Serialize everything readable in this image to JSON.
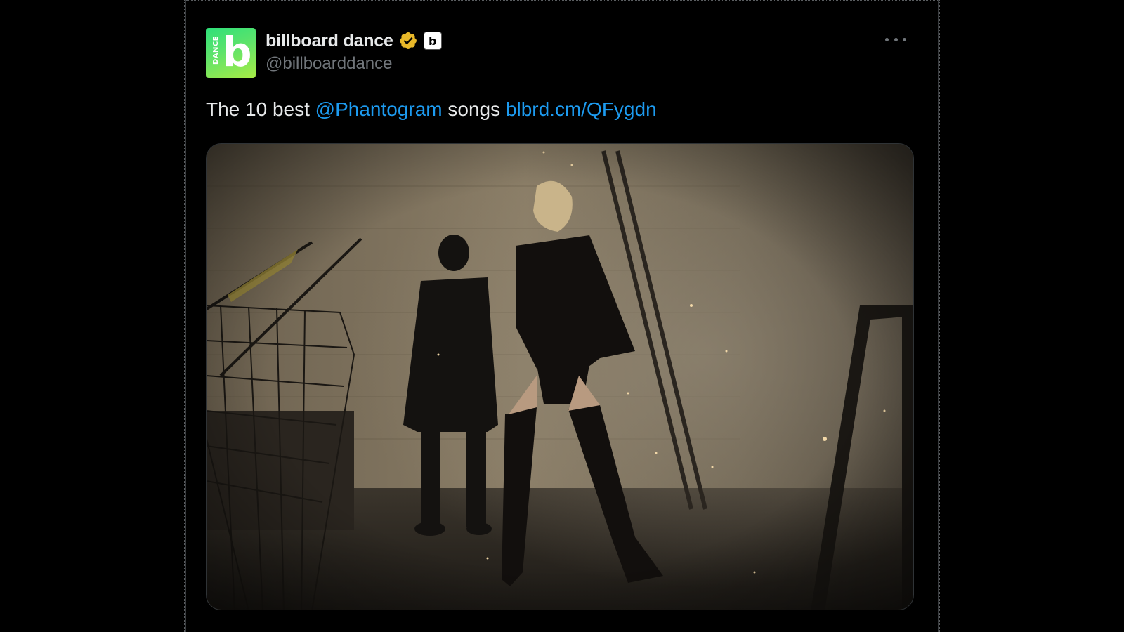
{
  "account": {
    "display_name": "billboard dance",
    "handle": "@billboarddance",
    "avatar_letter": "b",
    "avatar_word": "DANCE",
    "affiliate_badge": "b",
    "verified": true
  },
  "tweet": {
    "text_prefix": "The 10 best ",
    "mention": "@Phantogram",
    "text_middle": " songs ",
    "link": "blbrd.cm/QFygdn"
  },
  "media": {
    "description_icon": "photo"
  },
  "colors": {
    "background": "#000000",
    "text": "#e7e9ea",
    "secondary_text": "#71767b",
    "link": "#1d9bf0",
    "verified_gold": "#e8b829"
  },
  "icons": {
    "more": "more-horizontal-icon",
    "verified": "verified-badge-icon",
    "affiliate": "affiliate-badge-icon"
  }
}
